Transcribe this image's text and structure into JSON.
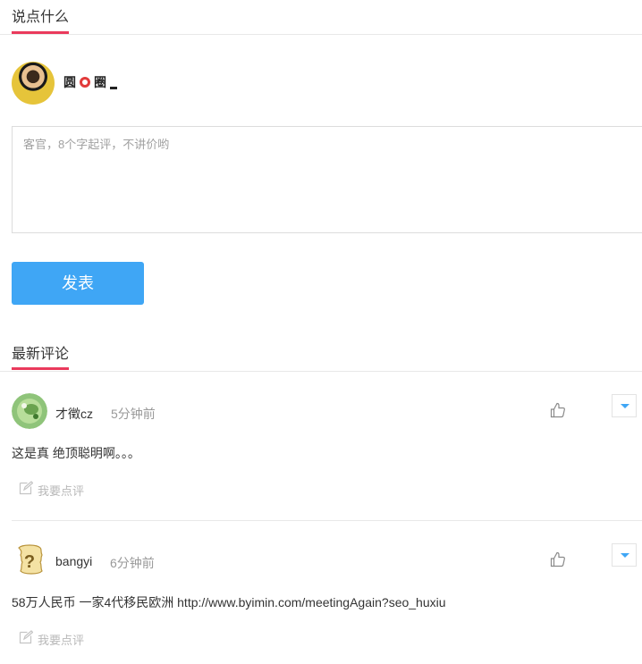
{
  "say_section": {
    "title": "说点什么"
  },
  "user": {
    "name_part1": "圆",
    "name_part2": "圈"
  },
  "editor": {
    "placeholder": "客官，8个字起评，不讲价哟"
  },
  "publish": {
    "label": "发表"
  },
  "latest_section": {
    "title": "最新评论"
  },
  "comments": [
    {
      "user": "才徵cz",
      "time": "5分钟前",
      "text": "这是真 绝顶聪明啊。。。",
      "review_label": "我要点评"
    },
    {
      "user": "bangyi",
      "time": "6分钟前",
      "text": "58万人民币 一家4代移民欧洲 http://www.byimin.com/meetingAgain?seo_huxiu",
      "review_label": "我要点评"
    }
  ],
  "colors": {
    "accent_underline": "#ea3a5c",
    "button_blue": "#3fa6f5"
  }
}
